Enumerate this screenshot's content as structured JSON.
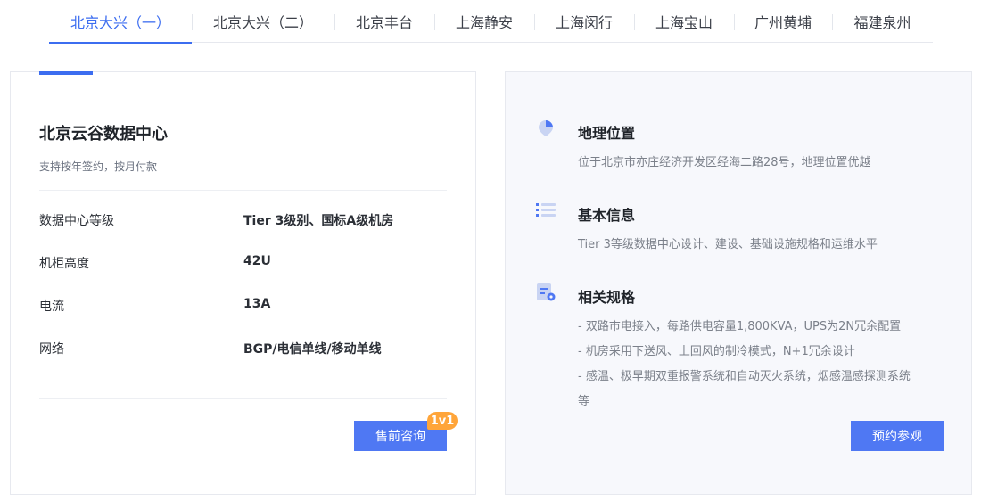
{
  "tabs": [
    {
      "label": "北京大兴（一）",
      "active": true
    },
    {
      "label": "北京大兴（二）",
      "active": false
    },
    {
      "label": "北京丰台",
      "active": false
    },
    {
      "label": "上海静安",
      "active": false
    },
    {
      "label": "上海闵行",
      "active": false
    },
    {
      "label": "上海宝山",
      "active": false
    },
    {
      "label": "广州黄埔",
      "active": false
    },
    {
      "label": "福建泉州",
      "active": false
    }
  ],
  "datacenter": {
    "title": "北京云谷数据中心",
    "subtitle": "支持按年签约，按月付款",
    "specs": [
      {
        "key": "数据中心等级",
        "value": "Tier 3级别、国标A级机房"
      },
      {
        "key": "机柜高度",
        "value": "42U"
      },
      {
        "key": "电流",
        "value": "13A"
      },
      {
        "key": "网络",
        "value": "BGP/电信单线/移动单线"
      }
    ],
    "presale_button": "售前咨询",
    "badge": "1v1"
  },
  "details": {
    "location": {
      "title": "地理位置",
      "text": "位于北京市亦庄经济开发区经海二路28号，地理位置优越",
      "icon": "location-pin-icon"
    },
    "basic": {
      "title": "基本信息",
      "text": "Tier 3等级数据中心设计、建设、基础设施规格和运维水平",
      "icon": "list-icon"
    },
    "specs": {
      "title": "相关规格",
      "icon": "document-settings-icon",
      "lines": [
        "- 双路市电接入，每路供电容量1,800KVA，UPS为2N冗余配置",
        "- 机房采用下送风、上回风的制冷模式，N+1冗余设计",
        "- 感温、极早期双重报警系统和自动灭火系统，烟感温感探测系统",
        "等"
      ]
    },
    "visit_button": "预约参观"
  },
  "colors": {
    "accent": "#3c6df0",
    "button": "#4f78f3",
    "badge": "#ffa53a"
  }
}
